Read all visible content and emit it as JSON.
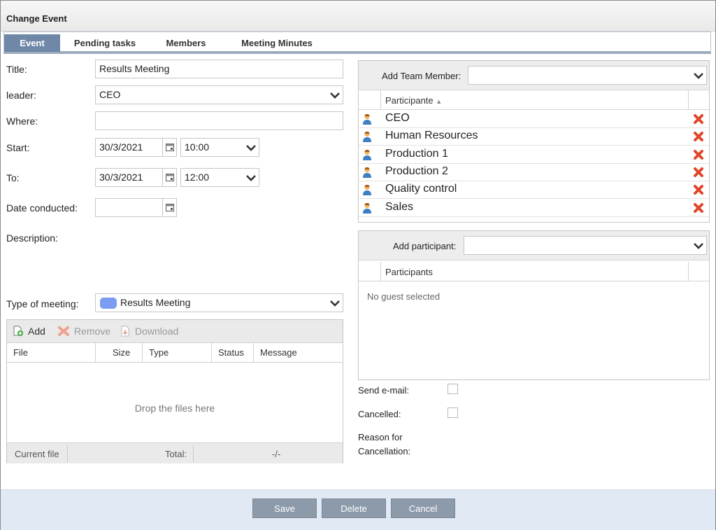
{
  "window": {
    "title": "Change Event"
  },
  "tabs": [
    {
      "label": "Event"
    },
    {
      "label": "Pending tasks"
    },
    {
      "label": "Members"
    },
    {
      "label": "Meeting Minutes"
    }
  ],
  "form": {
    "title_label": "Title:",
    "title_value": "Results Meeting",
    "leader_label": "leader:",
    "leader_value": "CEO",
    "where_label": "Where:",
    "where_value": "",
    "start_label": "Start:",
    "start_date": "30/3/2021",
    "start_time": "10:00",
    "to_label": "To:",
    "to_date": "30/3/2021",
    "to_time": "12:00",
    "date_conducted_label": "Date conducted:",
    "date_conducted_value": "",
    "description_label": "Description:",
    "type_label": "Type of meeting:",
    "type_value": "Results Meeting",
    "type_color": "#7b9cf0"
  },
  "upload": {
    "add": "Add",
    "remove": "Remove",
    "download": "Download",
    "columns": [
      "File",
      "Size",
      "Type",
      "Status",
      "Message"
    ],
    "drop_text": "Drop the files here",
    "current_file": "Current file",
    "total_label": "Total:",
    "total_value": "-/-"
  },
  "team": {
    "add_label": "Add Team Member:",
    "add_value": "",
    "column": "Participante",
    "members": [
      "CEO",
      "Human Resources",
      "Production 1",
      "Production 2",
      "Quality control",
      "Sales"
    ]
  },
  "guests": {
    "add_label": "Add participant:",
    "add_value": "",
    "column": "Participants",
    "empty_text": "No guest selected"
  },
  "options": {
    "send_email_label": "Send e-mail:",
    "cancelled_label": "Cancelled:",
    "reason_label_1": "Reason for",
    "reason_label_2": "Cancellation:"
  },
  "buttons": {
    "save": "Save",
    "delete": "Delete",
    "cancel": "Cancel"
  },
  "colors": {
    "accent": "#6f88a7",
    "button": "#8c9aaa",
    "delete_icon": "#e0462b",
    "footer": "#e1e9f5"
  }
}
